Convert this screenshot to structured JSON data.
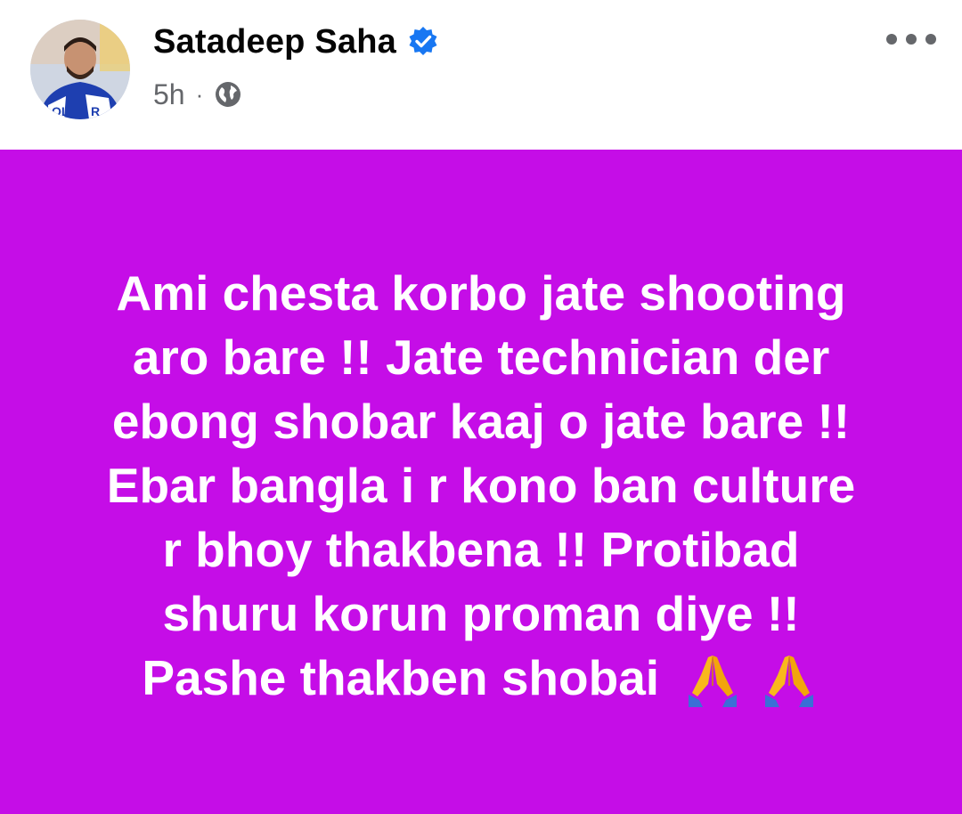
{
  "post": {
    "author": {
      "name": "Satadeep Saha",
      "verified_icon": "verified-badge-icon",
      "avatar_icon": "avatar"
    },
    "meta": {
      "time": "5h",
      "separator": "·",
      "audience_icon": "globe-icon"
    },
    "more_icon": "more-options-icon",
    "background_color": "#c50de7",
    "text": {
      "lines": [
        "Ami chesta korbo jate shooting",
        "aro bare !! Jate technician der",
        "ebong shobar kaaj o jate bare !!",
        "Ebar bangla i r kono ban culture",
        "r bhoy thakbena !! Protibad",
        "shuru korun proman diye !!",
        "Pashe thakben shobai"
      ],
      "emojis": [
        "folded-hands-icon",
        "folded-hands-icon"
      ]
    }
  },
  "colors": {
    "name": "#050505",
    "meta": "#65676b",
    "verified": "#1877f2",
    "post_bg": "#c50de7",
    "post_text": "#ffffff"
  }
}
